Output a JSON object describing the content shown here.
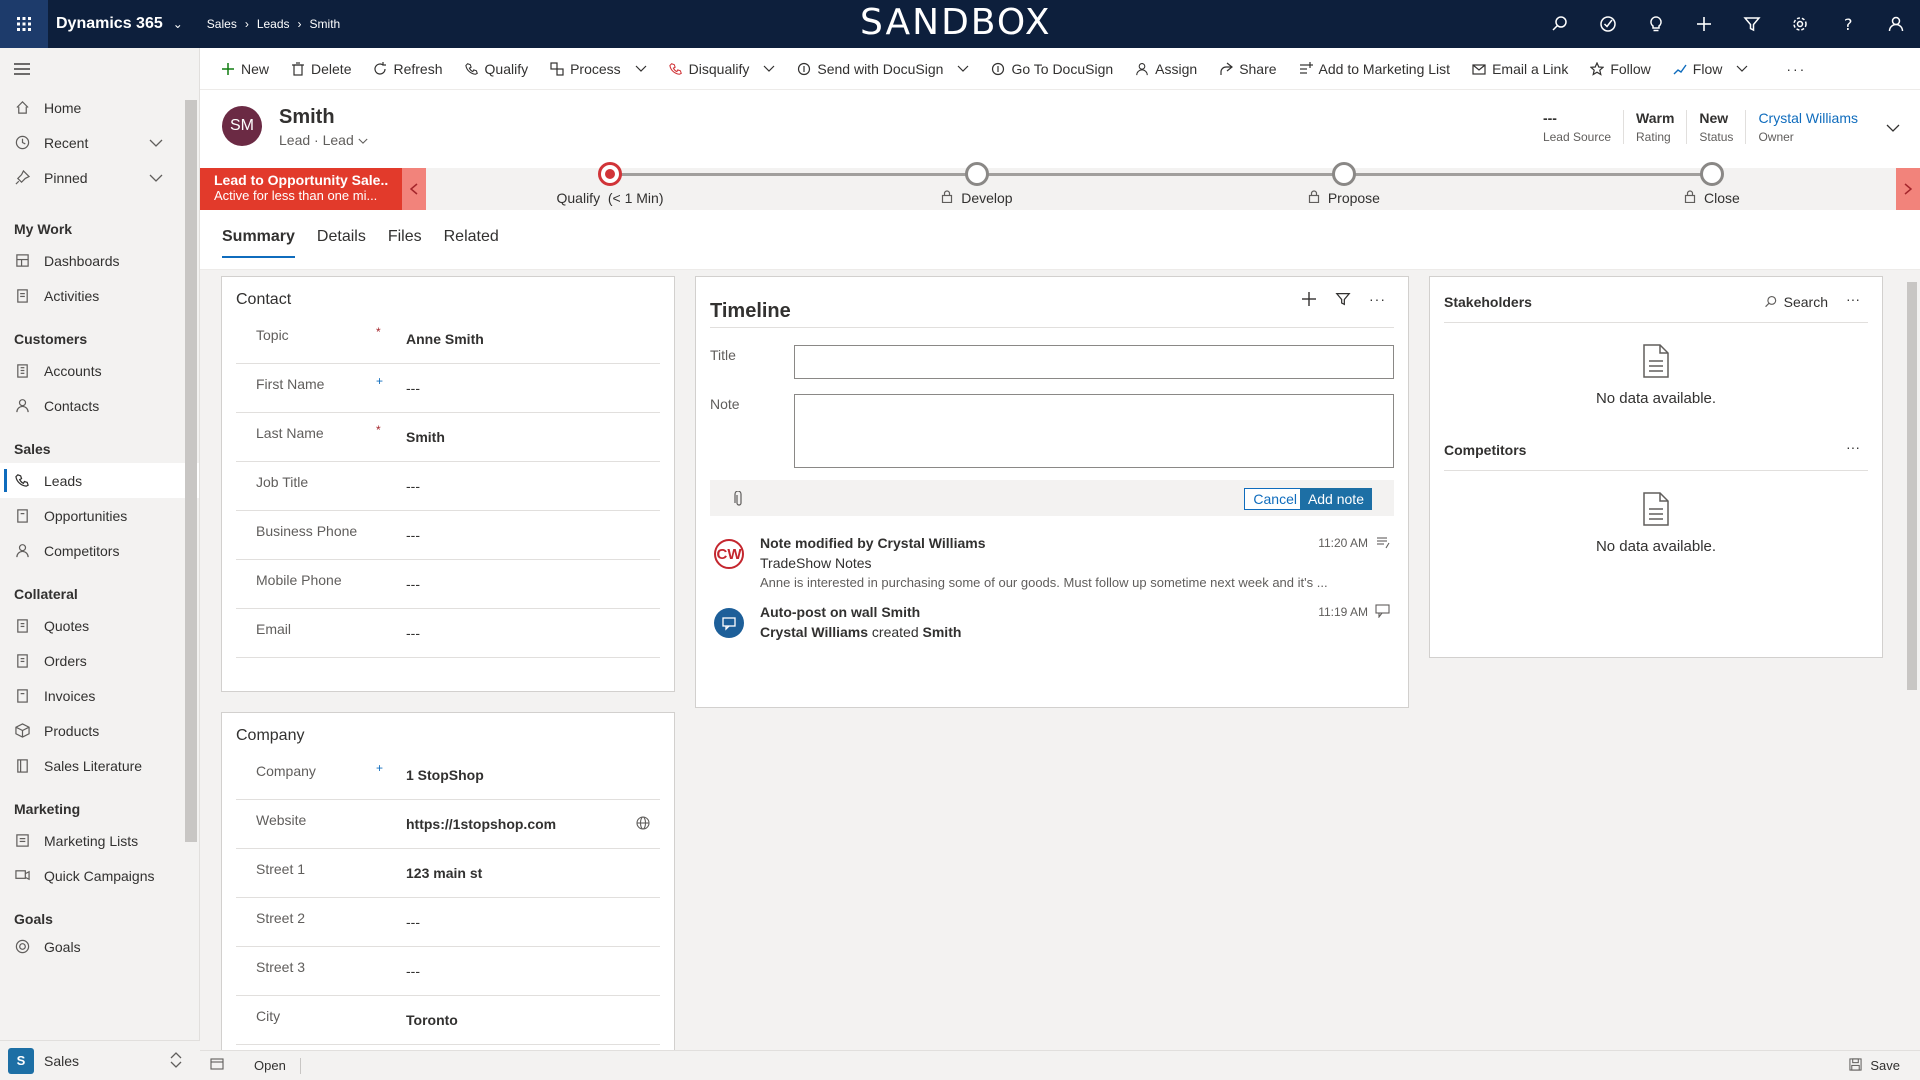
{
  "topbar": {
    "app_name": "Dynamics 365",
    "watermark": "SANDBOX",
    "breadcrumbs": [
      "Sales",
      "Leads",
      "Smith"
    ],
    "bg_color": "#0d1f3c"
  },
  "sidebar": {
    "items_top": [
      {
        "label": "Home",
        "icon": "home-icon"
      },
      {
        "label": "Recent",
        "icon": "clock-icon"
      },
      {
        "label": "Pinned",
        "icon": "pin-icon"
      }
    ],
    "sections": [
      {
        "title": "My Work",
        "items": [
          "Dashboards",
          "Activities"
        ]
      },
      {
        "title": "Customers",
        "items": [
          "Accounts",
          "Contacts"
        ]
      },
      {
        "title": "Sales",
        "items": [
          "Leads",
          "Opportunities",
          "Competitors"
        ]
      },
      {
        "title": "Collateral",
        "items": [
          "Quotes",
          "Orders",
          "Invoices",
          "Products",
          "Sales Literature"
        ]
      },
      {
        "title": "Marketing",
        "items": [
          "Marketing Lists",
          "Quick Campaigns"
        ]
      },
      {
        "title": "Goals",
        "items": [
          "Goals"
        ]
      }
    ],
    "active_item": "Leads",
    "area_badge": "S",
    "area_label": "Sales"
  },
  "commands": [
    "New",
    "Delete",
    "Refresh",
    "Qualify",
    "Process",
    "Disqualify",
    "Send with DocuSign",
    "Go To DocuSign",
    "Assign",
    "Share",
    "Add to Marketing List",
    "Email a Link",
    "Follow",
    "Flow"
  ],
  "record": {
    "initials": "SM",
    "title": "Smith",
    "entity": "Lead",
    "form": "Lead",
    "avatar_color": "#6b2a44",
    "header_fields": [
      {
        "value": "---",
        "label": "Lead Source"
      },
      {
        "value": "Warm",
        "label": "Rating"
      },
      {
        "value": "New",
        "label": "Status"
      },
      {
        "value": "Crystal Williams",
        "label": "Owner"
      }
    ]
  },
  "bpf": {
    "flyout_title": "Lead to Opportunity Sale...",
    "flyout_sub": "Active for less than one mi...",
    "stages": [
      {
        "label": "Qualify",
        "extra": "(< 1 Min)"
      },
      {
        "label": "Develop",
        "extra": ""
      },
      {
        "label": "Propose",
        "extra": ""
      },
      {
        "label": "Close",
        "extra": ""
      }
    ],
    "accent": "#e23a2b"
  },
  "tabs": [
    "Summary",
    "Details",
    "Files",
    "Related"
  ],
  "contact": {
    "title": "Contact",
    "fields": [
      {
        "label": "Topic",
        "req": "*",
        "value": "Anne Smith"
      },
      {
        "label": "First Name",
        "req": "+",
        "value": "---"
      },
      {
        "label": "Last Name",
        "req": "*",
        "value": "Smith"
      },
      {
        "label": "Job Title",
        "req": "",
        "value": "---"
      },
      {
        "label": "Business Phone",
        "req": "",
        "value": "---"
      },
      {
        "label": "Mobile Phone",
        "req": "",
        "value": "---"
      },
      {
        "label": "Email",
        "req": "",
        "value": "---"
      }
    ]
  },
  "company": {
    "title": "Company",
    "fields": [
      {
        "label": "Company",
        "req": "+",
        "value": "1 StopShop"
      },
      {
        "label": "Website",
        "req": "",
        "value": "https://1stopshop.com"
      },
      {
        "label": "Street 1",
        "req": "",
        "value": "123 main st"
      },
      {
        "label": "Street 2",
        "req": "",
        "value": "---"
      },
      {
        "label": "Street 3",
        "req": "",
        "value": "---"
      },
      {
        "label": "City",
        "req": "",
        "value": "Toronto"
      }
    ]
  },
  "timeline": {
    "title": "Timeline",
    "title_label": "Title",
    "note_label": "Note",
    "cancel": "Cancel",
    "add_note": "Add note",
    "posts": [
      {
        "initials": "CW",
        "heading": "Note modified by Crystal Williams",
        "time": "11:20 AM",
        "line2": "TradeShow Notes",
        "line3": "Anne is interested in purchasing some of our goods. Must follow up sometime next week and it's ..."
      },
      {
        "initials": "",
        "heading": "Auto-post on wall Smith",
        "time": "11:19 AM",
        "line2a": "Crystal Williams",
        "line2b": "created",
        "line2c": "Smith"
      }
    ]
  },
  "stakeholders": {
    "title": "Stakeholders",
    "search": "Search",
    "empty": "No data available."
  },
  "competitors": {
    "title": "Competitors",
    "empty": "No data available."
  },
  "statusbar": {
    "state": "Open",
    "save": "Save"
  }
}
